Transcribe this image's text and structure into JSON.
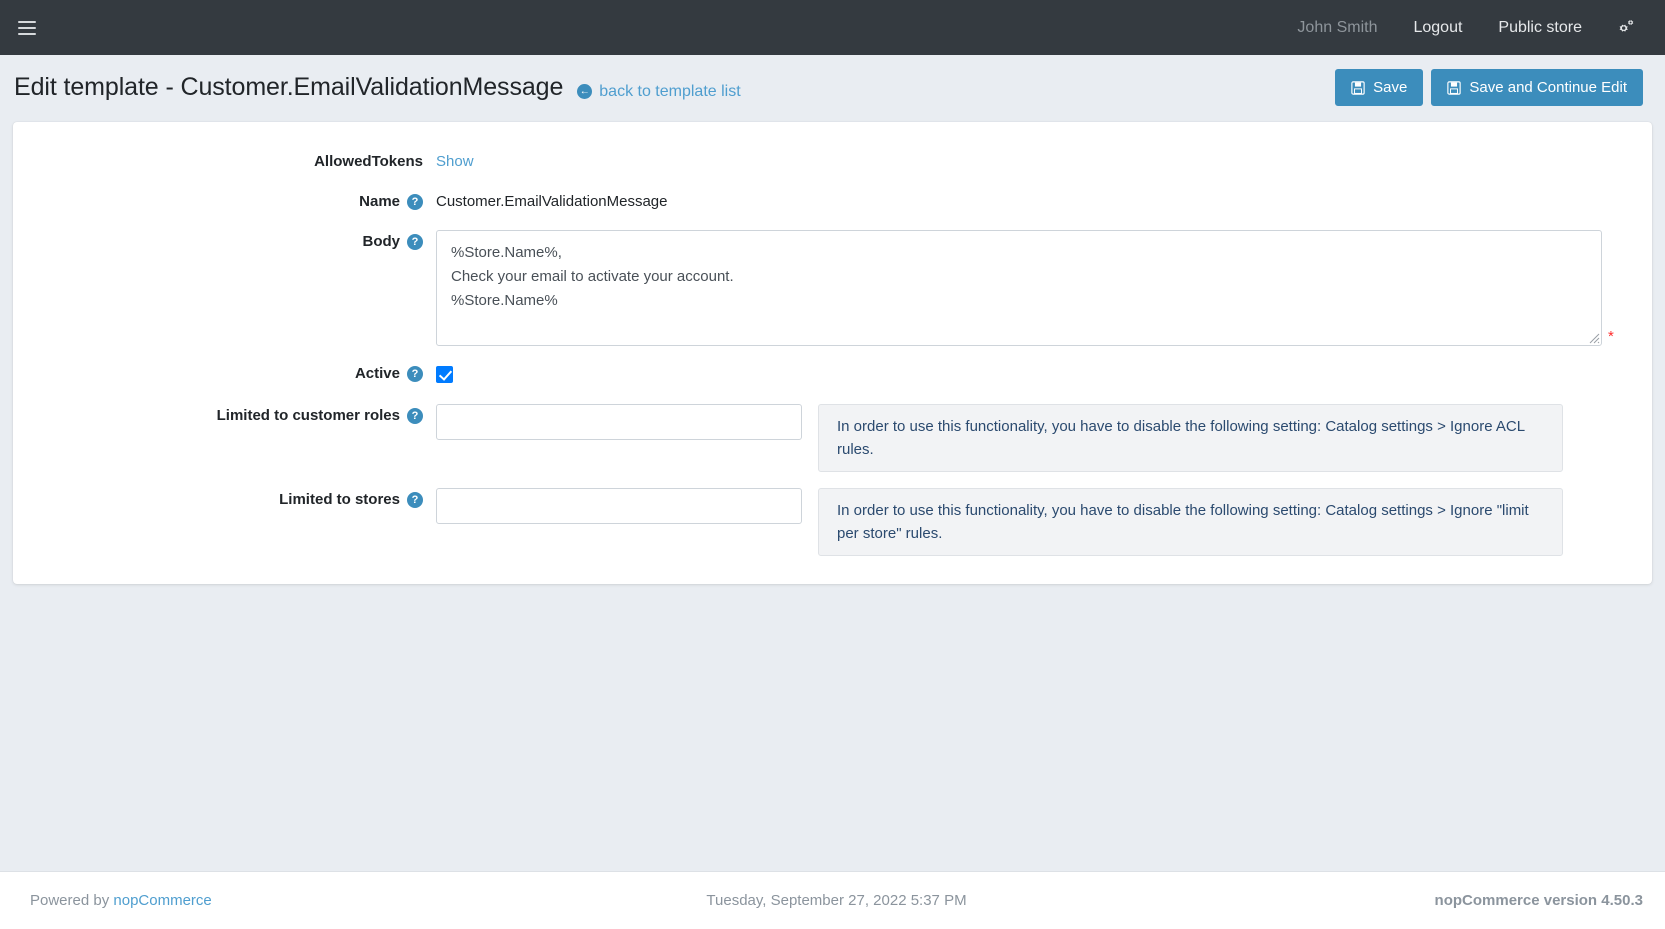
{
  "navbar": {
    "menu_icon": "hamburger-icon",
    "user_name": "John Smith",
    "logout_label": "Logout",
    "public_store_label": "Public store",
    "settings_icon": "gears-icon"
  },
  "header": {
    "title": "Edit template - Customer.EmailValidationMessage",
    "back_link_label": "back to template list",
    "back_link_icon": "arrow-left-circle-icon",
    "save_label": "Save",
    "save_continue_label": "Save and Continue Edit",
    "save_icon": "floppy-disk-icon"
  },
  "form": {
    "allowed_tokens": {
      "label": "AllowedTokens",
      "show_label": "Show"
    },
    "name": {
      "label": "Name",
      "help_icon": "question-circle-icon",
      "value": "Customer.EmailValidationMessage"
    },
    "body": {
      "label": "Body",
      "help_icon": "question-circle-icon",
      "value": "%Store.Name%,\nCheck your email to activate your account.\n%Store.Name%",
      "required_marker": "*"
    },
    "active": {
      "label": "Active",
      "help_icon": "question-circle-icon",
      "checked": true
    },
    "limited_to_customer_roles": {
      "label": "Limited to customer roles",
      "help_icon": "question-circle-icon",
      "value": "",
      "alert": "In order to use this functionality, you have to disable the following setting: Catalog settings > Ignore ACL rules."
    },
    "limited_to_stores": {
      "label": "Limited to stores",
      "help_icon": "question-circle-icon",
      "value": "",
      "alert": "In order to use this functionality, you have to disable the following setting: Catalog settings > Ignore \"limit per store\" rules."
    }
  },
  "footer": {
    "powered_by_prefix": "Powered by ",
    "powered_by_link": "nopCommerce",
    "datetime": "Tuesday, September 27, 2022 5:37 PM",
    "version": "nopCommerce version 4.50.3"
  },
  "colors": {
    "navbar_bg": "#343a40",
    "accent": "#3c8dbc",
    "page_bg": "#e9edf2",
    "link": "#4f9ecf",
    "required": "#ff2d2d",
    "checkbox": "#007bff"
  }
}
